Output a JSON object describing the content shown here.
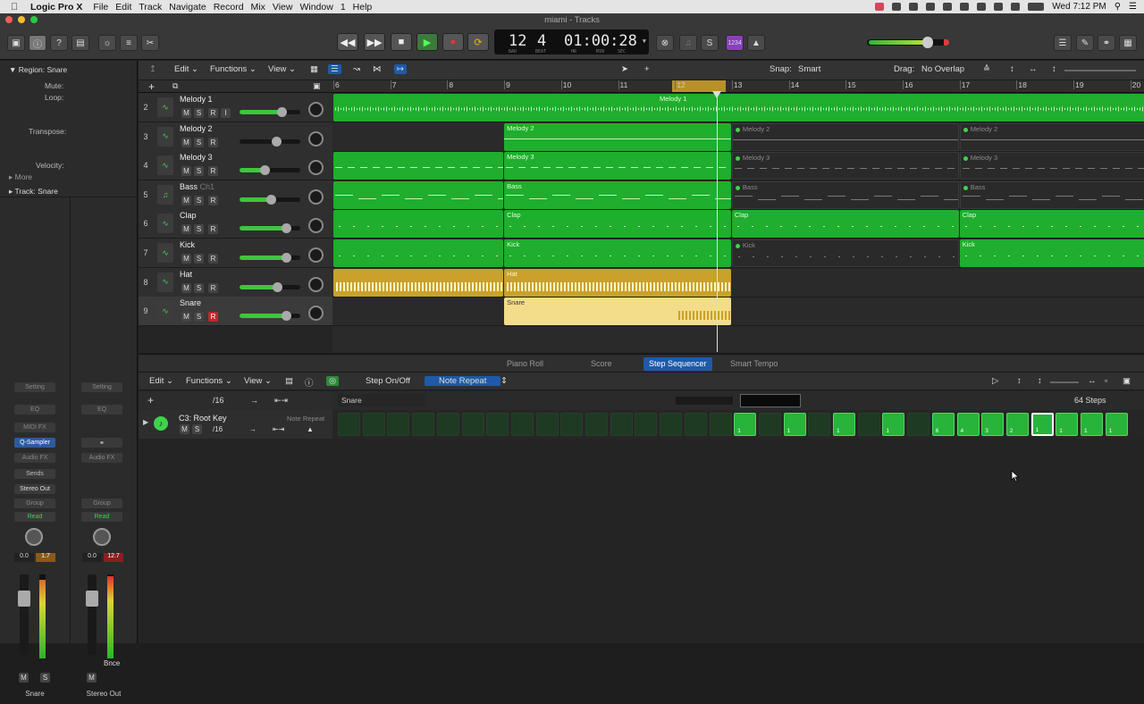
{
  "menubar": {
    "app": "Logic Pro X",
    "items": [
      "File",
      "Edit",
      "Track",
      "Navigate",
      "Record",
      "Mix",
      "View",
      "Window",
      "1",
      "Help"
    ],
    "clock": "Wed 7:12 PM"
  },
  "window": {
    "title": "miami - Tracks"
  },
  "transport": {
    "position_bars": "12",
    "position_beats": "4",
    "time": "01:00:28",
    "bar_label": "BAR",
    "beat_label": "BEAT",
    "hr_label": "HR",
    "min_label": "MIN",
    "sec_label": "SEC",
    "count_badge": "1234"
  },
  "inspector": {
    "region_header": "Region: Snare",
    "mute": "Mute:",
    "loop": "Loop:",
    "transpose": "Transpose:",
    "velocity": "Velocity:",
    "more": "More",
    "track_header": "Track:",
    "track_name": "Snare",
    "strip1": {
      "setting": "Setting",
      "eq": "EQ",
      "midi_fx": "MIDI FX",
      "instrument": "Q-Sampler",
      "audio_fx": "Audio FX",
      "sends": "Sends",
      "output": "Stereo Out",
      "group": "Group",
      "automation": "Read",
      "vol": "0.0",
      "peak": "1.7",
      "m": "M",
      "s": "S",
      "name": "Snare"
    },
    "strip2": {
      "setting": "Setting",
      "eq": "EQ",
      "audio_fx": "Audio FX",
      "group": "Group",
      "automation": "Read",
      "vol": "0.0",
      "peak": "12.7",
      "bounce": "Bnce",
      "m": "M",
      "name": "Stereo Out"
    }
  },
  "arrange_toolbar": {
    "edit": "Edit",
    "functions": "Functions",
    "view": "View",
    "snap_label": "Snap:",
    "snap_value": "Smart",
    "drag_label": "Drag:",
    "drag_value": "No Overlap"
  },
  "ruler": [
    "6",
    "7",
    "8",
    "9",
    "10",
    "11",
    "12",
    "13",
    "14",
    "15",
    "16",
    "17",
    "18",
    "19",
    "20"
  ],
  "tracks": [
    {
      "num": "2",
      "name": "Melody 1",
      "sub": "",
      "m": "M",
      "s": "S",
      "r": "R",
      "i": "I"
    },
    {
      "num": "3",
      "name": "Melody 2",
      "sub": "",
      "m": "M",
      "s": "S",
      "r": "R"
    },
    {
      "num": "4",
      "name": "Melody 3",
      "sub": "",
      "m": "M",
      "s": "S",
      "r": "R"
    },
    {
      "num": "5",
      "name": "Bass",
      "sub": "Ch1",
      "m": "M",
      "s": "S",
      "r": "R"
    },
    {
      "num": "6",
      "name": "Clap",
      "sub": "",
      "m": "M",
      "s": "S",
      "r": "R"
    },
    {
      "num": "7",
      "name": "Kick",
      "sub": "",
      "m": "M",
      "s": "S",
      "r": "R"
    },
    {
      "num": "8",
      "name": "Hat",
      "sub": "",
      "m": "M",
      "s": "S",
      "r": "R"
    },
    {
      "num": "9",
      "name": "Snare",
      "sub": "",
      "m": "M",
      "s": "S",
      "r": "R"
    }
  ],
  "regions": {
    "melody1": "Melody 1",
    "melody2": "Melody 2",
    "melody3": "Melody 3",
    "bass": "Bass",
    "clap": "Clap",
    "kick": "Kick",
    "hat": "Hat",
    "snare": "Snare"
  },
  "editor": {
    "tabs": [
      "Piano Roll",
      "Score",
      "Step Sequencer",
      "Smart Tempo"
    ],
    "active_tab": "Step Sequencer",
    "edit": "Edit",
    "functions": "Functions",
    "view": "View",
    "step_onoff": "Step On/Off",
    "note_repeat": "Note Repeat",
    "resolution": "/16",
    "pattern_name": "Snare",
    "steps": "64 Steps",
    "row_name": "C3: Root Key",
    "row_mode": "Note Repeat",
    "row_resolution": "/16",
    "row_m": "M",
    "row_s": "S"
  }
}
